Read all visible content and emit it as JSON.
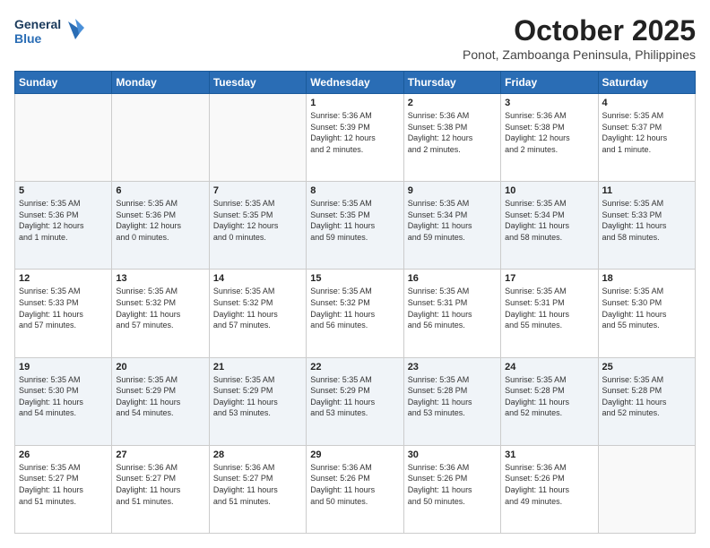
{
  "logo": {
    "general": "General",
    "blue": "Blue"
  },
  "header": {
    "month": "October 2025",
    "location": "Ponot, Zamboanga Peninsula, Philippines"
  },
  "weekdays": [
    "Sunday",
    "Monday",
    "Tuesday",
    "Wednesday",
    "Thursday",
    "Friday",
    "Saturday"
  ],
  "weeks": [
    [
      {
        "day": "",
        "info": ""
      },
      {
        "day": "",
        "info": ""
      },
      {
        "day": "",
        "info": ""
      },
      {
        "day": "1",
        "info": "Sunrise: 5:36 AM\nSunset: 5:39 PM\nDaylight: 12 hours\nand 2 minutes."
      },
      {
        "day": "2",
        "info": "Sunrise: 5:36 AM\nSunset: 5:38 PM\nDaylight: 12 hours\nand 2 minutes."
      },
      {
        "day": "3",
        "info": "Sunrise: 5:36 AM\nSunset: 5:38 PM\nDaylight: 12 hours\nand 2 minutes."
      },
      {
        "day": "4",
        "info": "Sunrise: 5:35 AM\nSunset: 5:37 PM\nDaylight: 12 hours\nand 1 minute."
      }
    ],
    [
      {
        "day": "5",
        "info": "Sunrise: 5:35 AM\nSunset: 5:36 PM\nDaylight: 12 hours\nand 1 minute."
      },
      {
        "day": "6",
        "info": "Sunrise: 5:35 AM\nSunset: 5:36 PM\nDaylight: 12 hours\nand 0 minutes."
      },
      {
        "day": "7",
        "info": "Sunrise: 5:35 AM\nSunset: 5:35 PM\nDaylight: 12 hours\nand 0 minutes."
      },
      {
        "day": "8",
        "info": "Sunrise: 5:35 AM\nSunset: 5:35 PM\nDaylight: 11 hours\nand 59 minutes."
      },
      {
        "day": "9",
        "info": "Sunrise: 5:35 AM\nSunset: 5:34 PM\nDaylight: 11 hours\nand 59 minutes."
      },
      {
        "day": "10",
        "info": "Sunrise: 5:35 AM\nSunset: 5:34 PM\nDaylight: 11 hours\nand 58 minutes."
      },
      {
        "day": "11",
        "info": "Sunrise: 5:35 AM\nSunset: 5:33 PM\nDaylight: 11 hours\nand 58 minutes."
      }
    ],
    [
      {
        "day": "12",
        "info": "Sunrise: 5:35 AM\nSunset: 5:33 PM\nDaylight: 11 hours\nand 57 minutes."
      },
      {
        "day": "13",
        "info": "Sunrise: 5:35 AM\nSunset: 5:32 PM\nDaylight: 11 hours\nand 57 minutes."
      },
      {
        "day": "14",
        "info": "Sunrise: 5:35 AM\nSunset: 5:32 PM\nDaylight: 11 hours\nand 57 minutes."
      },
      {
        "day": "15",
        "info": "Sunrise: 5:35 AM\nSunset: 5:32 PM\nDaylight: 11 hours\nand 56 minutes."
      },
      {
        "day": "16",
        "info": "Sunrise: 5:35 AM\nSunset: 5:31 PM\nDaylight: 11 hours\nand 56 minutes."
      },
      {
        "day": "17",
        "info": "Sunrise: 5:35 AM\nSunset: 5:31 PM\nDaylight: 11 hours\nand 55 minutes."
      },
      {
        "day": "18",
        "info": "Sunrise: 5:35 AM\nSunset: 5:30 PM\nDaylight: 11 hours\nand 55 minutes."
      }
    ],
    [
      {
        "day": "19",
        "info": "Sunrise: 5:35 AM\nSunset: 5:30 PM\nDaylight: 11 hours\nand 54 minutes."
      },
      {
        "day": "20",
        "info": "Sunrise: 5:35 AM\nSunset: 5:29 PM\nDaylight: 11 hours\nand 54 minutes."
      },
      {
        "day": "21",
        "info": "Sunrise: 5:35 AM\nSunset: 5:29 PM\nDaylight: 11 hours\nand 53 minutes."
      },
      {
        "day": "22",
        "info": "Sunrise: 5:35 AM\nSunset: 5:29 PM\nDaylight: 11 hours\nand 53 minutes."
      },
      {
        "day": "23",
        "info": "Sunrise: 5:35 AM\nSunset: 5:28 PM\nDaylight: 11 hours\nand 53 minutes."
      },
      {
        "day": "24",
        "info": "Sunrise: 5:35 AM\nSunset: 5:28 PM\nDaylight: 11 hours\nand 52 minutes."
      },
      {
        "day": "25",
        "info": "Sunrise: 5:35 AM\nSunset: 5:28 PM\nDaylight: 11 hours\nand 52 minutes."
      }
    ],
    [
      {
        "day": "26",
        "info": "Sunrise: 5:35 AM\nSunset: 5:27 PM\nDaylight: 11 hours\nand 51 minutes."
      },
      {
        "day": "27",
        "info": "Sunrise: 5:36 AM\nSunset: 5:27 PM\nDaylight: 11 hours\nand 51 minutes."
      },
      {
        "day": "28",
        "info": "Sunrise: 5:36 AM\nSunset: 5:27 PM\nDaylight: 11 hours\nand 51 minutes."
      },
      {
        "day": "29",
        "info": "Sunrise: 5:36 AM\nSunset: 5:26 PM\nDaylight: 11 hours\nand 50 minutes."
      },
      {
        "day": "30",
        "info": "Sunrise: 5:36 AM\nSunset: 5:26 PM\nDaylight: 11 hours\nand 50 minutes."
      },
      {
        "day": "31",
        "info": "Sunrise: 5:36 AM\nSunset: 5:26 PM\nDaylight: 11 hours\nand 49 minutes."
      },
      {
        "day": "",
        "info": ""
      }
    ]
  ]
}
